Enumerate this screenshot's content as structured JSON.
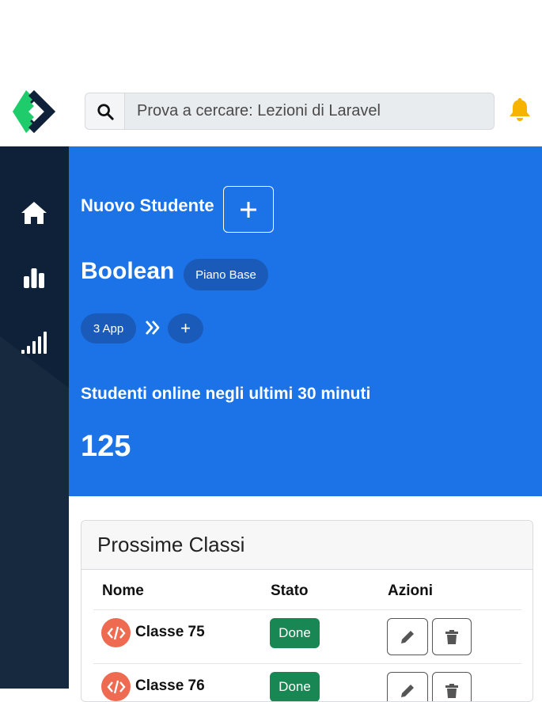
{
  "search": {
    "placeholder": "Prova a cercare: Lezioni di Laravel"
  },
  "sidebar": {
    "items": [
      {
        "icon": "home-icon"
      },
      {
        "icon": "bar-chart-icon"
      },
      {
        "icon": "signal-icon"
      }
    ]
  },
  "hero": {
    "new_student_label": "Nuovo Studente",
    "school_name": "Boolean",
    "plan_badge": "Piano Base",
    "apps_badge": "3 App",
    "add_symbol": "+",
    "online_label": "Studenti online negli ultimi 30 minuti",
    "online_count": "125"
  },
  "classes": {
    "title": "Prossime Classi",
    "columns": [
      "Nome",
      "Stato",
      "Azioni"
    ],
    "rows": [
      {
        "name": "Classe 75",
        "status": "Done"
      },
      {
        "name": "Classe 76",
        "status": "Done"
      }
    ]
  },
  "colors": {
    "primary": "#1c72e7",
    "sidebar": "#0f2138",
    "success": "#198754",
    "bell": "#f6b400",
    "code_icon": "#ee6b52",
    "logo_green": "#1fcc6b"
  }
}
